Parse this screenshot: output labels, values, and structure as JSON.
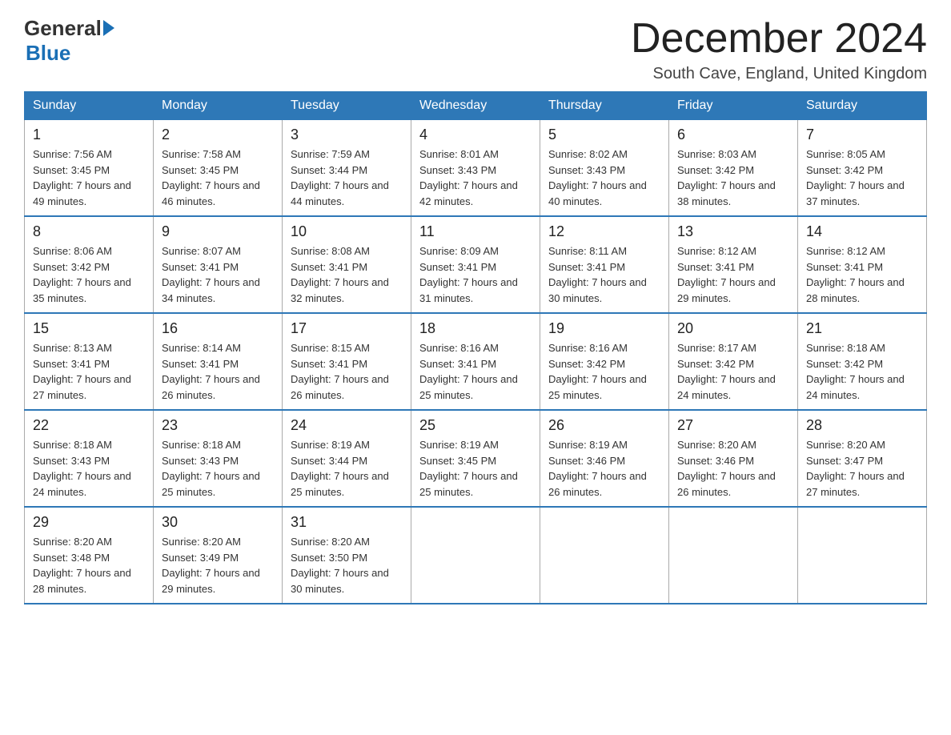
{
  "header": {
    "logo_general": "General",
    "logo_blue": "Blue",
    "title": "December 2024",
    "location": "South Cave, England, United Kingdom"
  },
  "days_of_week": [
    "Sunday",
    "Monday",
    "Tuesday",
    "Wednesday",
    "Thursday",
    "Friday",
    "Saturday"
  ],
  "weeks": [
    [
      {
        "day": "1",
        "sunrise": "7:56 AM",
        "sunset": "3:45 PM",
        "daylight": "7 hours and 49 minutes."
      },
      {
        "day": "2",
        "sunrise": "7:58 AM",
        "sunset": "3:45 PM",
        "daylight": "7 hours and 46 minutes."
      },
      {
        "day": "3",
        "sunrise": "7:59 AM",
        "sunset": "3:44 PM",
        "daylight": "7 hours and 44 minutes."
      },
      {
        "day": "4",
        "sunrise": "8:01 AM",
        "sunset": "3:43 PM",
        "daylight": "7 hours and 42 minutes."
      },
      {
        "day": "5",
        "sunrise": "8:02 AM",
        "sunset": "3:43 PM",
        "daylight": "7 hours and 40 minutes."
      },
      {
        "day": "6",
        "sunrise": "8:03 AM",
        "sunset": "3:42 PM",
        "daylight": "7 hours and 38 minutes."
      },
      {
        "day": "7",
        "sunrise": "8:05 AM",
        "sunset": "3:42 PM",
        "daylight": "7 hours and 37 minutes."
      }
    ],
    [
      {
        "day": "8",
        "sunrise": "8:06 AM",
        "sunset": "3:42 PM",
        "daylight": "7 hours and 35 minutes."
      },
      {
        "day": "9",
        "sunrise": "8:07 AM",
        "sunset": "3:41 PM",
        "daylight": "7 hours and 34 minutes."
      },
      {
        "day": "10",
        "sunrise": "8:08 AM",
        "sunset": "3:41 PM",
        "daylight": "7 hours and 32 minutes."
      },
      {
        "day": "11",
        "sunrise": "8:09 AM",
        "sunset": "3:41 PM",
        "daylight": "7 hours and 31 minutes."
      },
      {
        "day": "12",
        "sunrise": "8:11 AM",
        "sunset": "3:41 PM",
        "daylight": "7 hours and 30 minutes."
      },
      {
        "day": "13",
        "sunrise": "8:12 AM",
        "sunset": "3:41 PM",
        "daylight": "7 hours and 29 minutes."
      },
      {
        "day": "14",
        "sunrise": "8:12 AM",
        "sunset": "3:41 PM",
        "daylight": "7 hours and 28 minutes."
      }
    ],
    [
      {
        "day": "15",
        "sunrise": "8:13 AM",
        "sunset": "3:41 PM",
        "daylight": "7 hours and 27 minutes."
      },
      {
        "day": "16",
        "sunrise": "8:14 AM",
        "sunset": "3:41 PM",
        "daylight": "7 hours and 26 minutes."
      },
      {
        "day": "17",
        "sunrise": "8:15 AM",
        "sunset": "3:41 PM",
        "daylight": "7 hours and 26 minutes."
      },
      {
        "day": "18",
        "sunrise": "8:16 AM",
        "sunset": "3:41 PM",
        "daylight": "7 hours and 25 minutes."
      },
      {
        "day": "19",
        "sunrise": "8:16 AM",
        "sunset": "3:42 PM",
        "daylight": "7 hours and 25 minutes."
      },
      {
        "day": "20",
        "sunrise": "8:17 AM",
        "sunset": "3:42 PM",
        "daylight": "7 hours and 24 minutes."
      },
      {
        "day": "21",
        "sunrise": "8:18 AM",
        "sunset": "3:42 PM",
        "daylight": "7 hours and 24 minutes."
      }
    ],
    [
      {
        "day": "22",
        "sunrise": "8:18 AM",
        "sunset": "3:43 PM",
        "daylight": "7 hours and 24 minutes."
      },
      {
        "day": "23",
        "sunrise": "8:18 AM",
        "sunset": "3:43 PM",
        "daylight": "7 hours and 25 minutes."
      },
      {
        "day": "24",
        "sunrise": "8:19 AM",
        "sunset": "3:44 PM",
        "daylight": "7 hours and 25 minutes."
      },
      {
        "day": "25",
        "sunrise": "8:19 AM",
        "sunset": "3:45 PM",
        "daylight": "7 hours and 25 minutes."
      },
      {
        "day": "26",
        "sunrise": "8:19 AM",
        "sunset": "3:46 PM",
        "daylight": "7 hours and 26 minutes."
      },
      {
        "day": "27",
        "sunrise": "8:20 AM",
        "sunset": "3:46 PM",
        "daylight": "7 hours and 26 minutes."
      },
      {
        "day": "28",
        "sunrise": "8:20 AM",
        "sunset": "3:47 PM",
        "daylight": "7 hours and 27 minutes."
      }
    ],
    [
      {
        "day": "29",
        "sunrise": "8:20 AM",
        "sunset": "3:48 PM",
        "daylight": "7 hours and 28 minutes."
      },
      {
        "day": "30",
        "sunrise": "8:20 AM",
        "sunset": "3:49 PM",
        "daylight": "7 hours and 29 minutes."
      },
      {
        "day": "31",
        "sunrise": "8:20 AM",
        "sunset": "3:50 PM",
        "daylight": "7 hours and 30 minutes."
      },
      null,
      null,
      null,
      null
    ]
  ]
}
